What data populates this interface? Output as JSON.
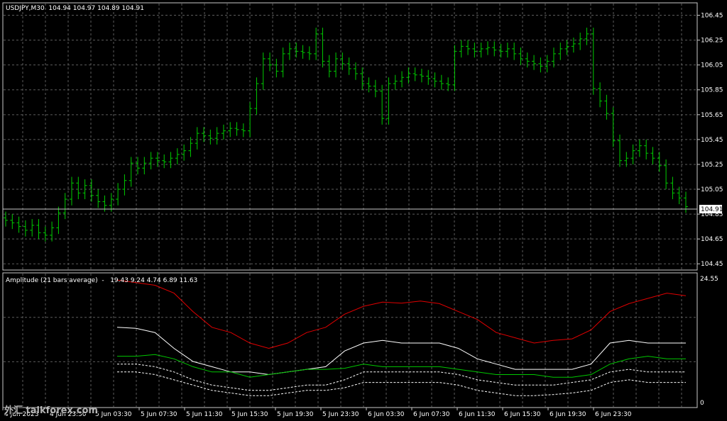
{
  "colors": {
    "background": "#000000",
    "grid": "#5c5c5c",
    "frame": "#c8c8c8",
    "bars": "#00cc00",
    "text": "#ffffff",
    "line_red": "#e00000",
    "line_white": "#ffffff",
    "line_green": "#00c800",
    "line_dashed": "#ffffff"
  },
  "main_chart": {
    "header": "USDJPY,M30  104.94 104.97 104.89 104.91",
    "price_labels": [
      "106.45",
      "106.25",
      "106.05",
      "105.85",
      "105.65",
      "105.45",
      "105.25",
      "105.05",
      "104.85",
      "104.65",
      "104.45"
    ],
    "current_price": "104.91"
  },
  "indicator": {
    "header": "Amplitude (21 bars average)  -   19.43 9.24 4.74 6.89 11.63",
    "scale_top": "24.55",
    "scale_bottom": "0"
  },
  "time_labels": [
    "4 Jun 2023",
    "4 Jun 23:30",
    "5 Jun 03:30",
    "5 Jun 07:30",
    "5 Jun 11:30",
    "5 Jun 15:30",
    "5 Jun 19:30",
    "5 Jun 23:30",
    "6 Jun 03:30",
    "6 Jun 07:30",
    "6 Jun 11:30",
    "6 Jun 15:30",
    "6 Jun 19:30",
    "6 Jun 23:30"
  ],
  "watermark": "外汇 talkforex.com",
  "chart_data": {
    "type": "ohlc",
    "symbol": "USDJPY",
    "timeframe": "M30",
    "ylim": [
      104.4,
      106.55
    ],
    "price_close": [
      104.8,
      104.78,
      104.75,
      104.72,
      104.76,
      104.7,
      104.68,
      104.74,
      104.86,
      104.97,
      105.1,
      105.02,
      105.08,
      105.0,
      104.95,
      104.92,
      104.97,
      105.05,
      105.12,
      105.26,
      105.22,
      105.26,
      105.3,
      105.28,
      105.27,
      105.3,
      105.33,
      105.36,
      105.42,
      105.5,
      105.48,
      105.46,
      105.5,
      105.52,
      105.54,
      105.53,
      105.52,
      105.7,
      105.9,
      106.1,
      106.05,
      106.0,
      106.14,
      106.18,
      106.16,
      106.15,
      106.14,
      106.3,
      106.08,
      106.0,
      106.1,
      106.06,
      106.02,
      105.98,
      105.9,
      105.88,
      105.84,
      105.62,
      105.9,
      105.92,
      105.95,
      105.98,
      105.97,
      105.96,
      105.94,
      105.92,
      105.9,
      105.89,
      106.16,
      106.2,
      106.18,
      106.16,
      106.18,
      106.19,
      106.17,
      106.16,
      106.18,
      106.14,
      106.1,
      106.08,
      106.06,
      106.04,
      106.08,
      106.14,
      106.18,
      106.2,
      106.22,
      106.26,
      106.3,
      105.86,
      105.76,
      105.66,
      105.44,
      105.28,
      105.3,
      105.36,
      105.4,
      105.34,
      105.3,
      105.24,
      105.1,
      105.02,
      104.98,
      104.91
    ],
    "amplitude": {
      "x_start_index": 28,
      "series": [
        {
          "values": [
            24.0,
            23.5,
            23.0,
            21.5,
            18.0,
            15.0,
            14.0,
            12.0,
            11.0,
            12.0,
            14.0,
            15.0,
            17.5,
            19.0,
            19.8,
            19.6,
            20.0,
            19.5,
            18.0,
            16.5,
            14.0,
            13.0,
            12.0,
            12.5,
            12.8,
            14.5,
            18.0,
            19.5,
            20.5,
            21.5,
            21.0
          ]
        },
        {
          "values": [
            15.0,
            14.8,
            14.0,
            11.0,
            8.5,
            7.5,
            6.5,
            6.5,
            6.0,
            6.5,
            7.0,
            7.5,
            10.5,
            12.0,
            12.5,
            12.0,
            12.0,
            12.0,
            11.0,
            9.0,
            8.0,
            7.0,
            7.0,
            7.0,
            7.0,
            8.0,
            12.0,
            12.5,
            12.0,
            12.0,
            12.0
          ]
        },
        {
          "values": [
            9.5,
            9.5,
            9.8,
            9.0,
            7.5,
            6.5,
            6.5,
            5.5,
            6.0,
            6.5,
            7.0,
            7.0,
            7.2,
            8.0,
            7.5,
            7.5,
            7.5,
            7.5,
            7.0,
            6.5,
            6.0,
            6.0,
            6.0,
            5.5,
            5.5,
            6.0,
            8.0,
            9.0,
            9.5,
            9.0,
            9.0
          ]
        },
        {
          "values": [
            8.0,
            8.0,
            7.5,
            6.5,
            5.0,
            4.0,
            3.5,
            3.0,
            3.0,
            3.5,
            4.0,
            4.0,
            5.0,
            6.5,
            6.5,
            6.5,
            6.5,
            6.5,
            6.0,
            5.0,
            4.5,
            4.0,
            4.0,
            4.0,
            4.5,
            5.0,
            6.5,
            7.0,
            6.5,
            6.5,
            6.5
          ]
        },
        {
          "values": [
            6.5,
            6.5,
            6.0,
            5.0,
            4.0,
            3.0,
            2.5,
            2.0,
            2.0,
            2.5,
            3.0,
            3.0,
            3.5,
            4.5,
            4.5,
            4.5,
            4.5,
            4.5,
            4.0,
            3.0,
            2.5,
            2.0,
            2.0,
            2.2,
            2.5,
            3.0,
            4.5,
            5.0,
            4.5,
            4.5,
            4.5
          ]
        }
      ],
      "ylim": [
        0,
        24.55
      ]
    }
  }
}
